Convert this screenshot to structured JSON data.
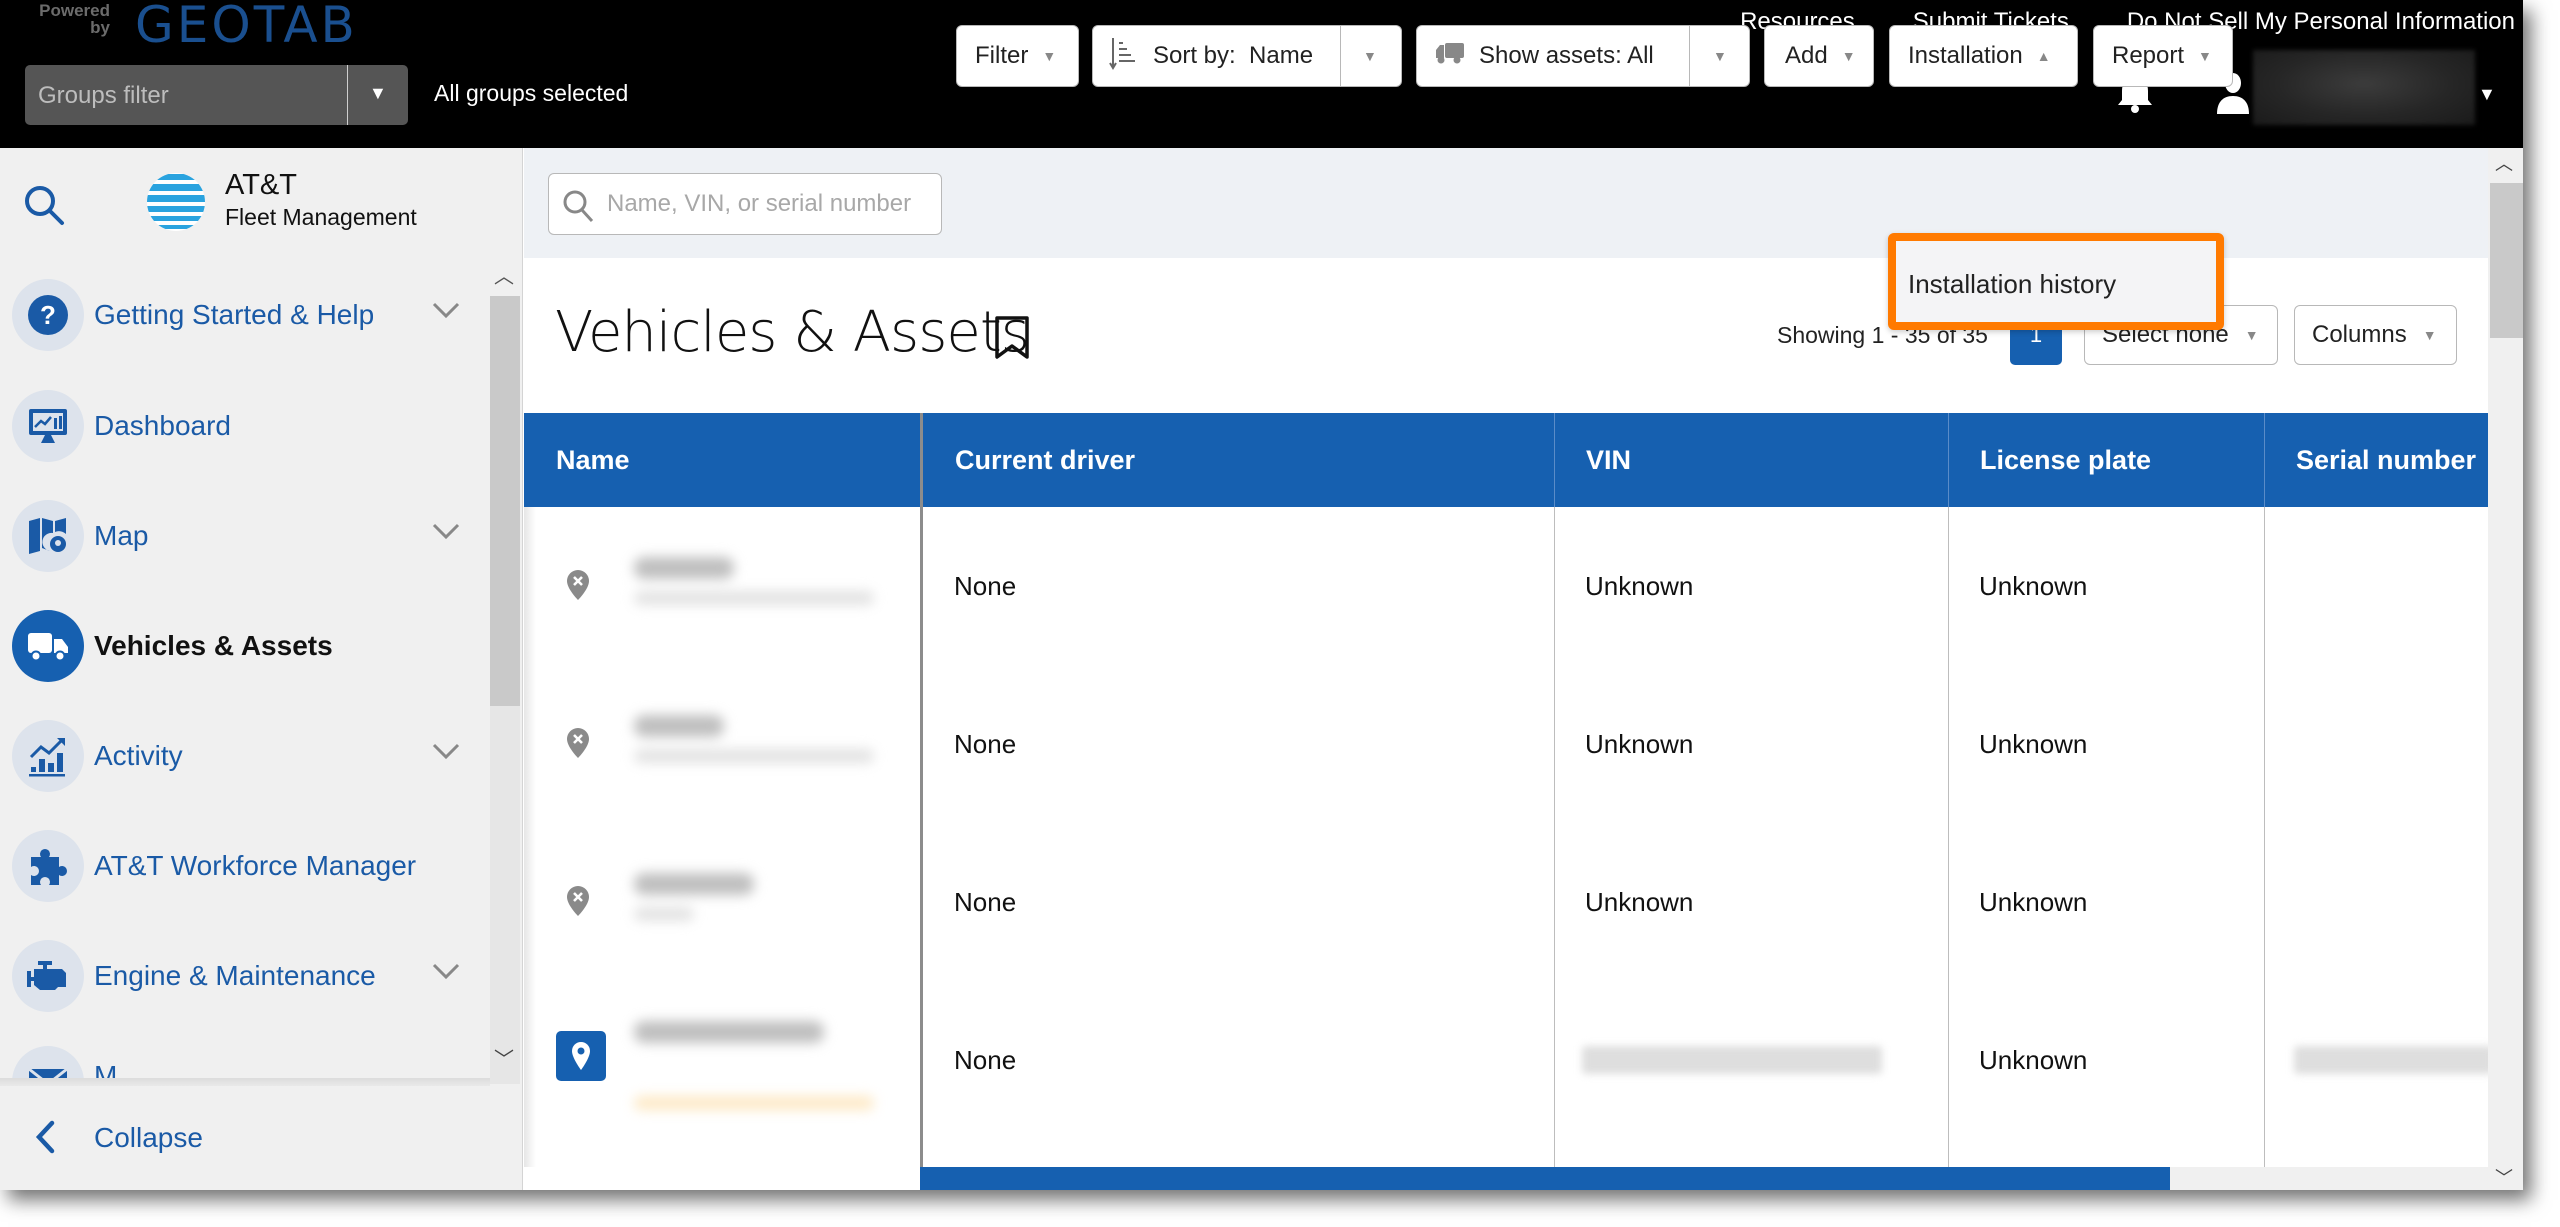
{
  "header": {
    "powered_by": "Powered by",
    "brand": "GEOTAB",
    "groups_filter_placeholder": "Groups filter",
    "groups_selected": "All groups selected",
    "links": [
      "Resources",
      "Submit Tickets",
      "Do Not Sell My Personal Information"
    ],
    "icons": {
      "notifications": "bell-icon",
      "user": "user-icon",
      "user_menu": "caret-down-icon"
    }
  },
  "sidebar": {
    "logo_title": "AT&T",
    "logo_subtitle": "Fleet Management",
    "items": [
      {
        "label": "Getting Started & Help",
        "icon": "help-icon",
        "expandable": true,
        "active": false
      },
      {
        "label": "Dashboard",
        "icon": "dashboard-icon",
        "expandable": false,
        "active": false
      },
      {
        "label": "Map",
        "icon": "map-icon",
        "expandable": true,
        "active": false
      },
      {
        "label": "Vehicles & Assets",
        "icon": "truck-icon",
        "expandable": false,
        "active": true
      },
      {
        "label": "Activity",
        "icon": "activity-chart-icon",
        "expandable": true,
        "active": false
      },
      {
        "label": "AT&T Workforce Manager",
        "icon": "puzzle-icon",
        "expandable": false,
        "active": false
      },
      {
        "label": "Engine & Maintenance",
        "icon": "engine-icon",
        "expandable": true,
        "active": false
      },
      {
        "label": "M...",
        "icon": "mail-icon",
        "expandable": false,
        "active": false
      }
    ],
    "collapse_label": "Collapse"
  },
  "toolbar": {
    "search_placeholder": "Name, VIN, or serial number",
    "filter_label": "Filter",
    "sort_label": "Sort by:  Name",
    "show_assets_label": "Show assets: All",
    "add_label": "Add",
    "installation_label": "Installation",
    "report_label": "Report"
  },
  "installation_menu": {
    "items": [
      "Installation history"
    ],
    "highlight_color": "#ff7a00"
  },
  "page": {
    "title": "Vehicles & Assets",
    "showing": "Showing 1 - 35 of 35",
    "current_page": "1",
    "select_label": "Select none",
    "columns_label": "Columns"
  },
  "table": {
    "columns": [
      "Name",
      "Current driver",
      "VIN",
      "License plate",
      "Serial number"
    ],
    "rows": [
      {
        "status_icon": "no-gps-pin-icon",
        "current_driver": "None",
        "vin": "Unknown",
        "license_plate": "Unknown",
        "serial_number": ""
      },
      {
        "status_icon": "no-gps-pin-icon",
        "current_driver": "None",
        "vin": "Unknown",
        "license_plate": "Unknown",
        "serial_number": ""
      },
      {
        "status_icon": "no-gps-pin-icon",
        "current_driver": "None",
        "vin": "Unknown",
        "license_plate": "Unknown",
        "serial_number": ""
      },
      {
        "status_icon": "location-pin-icon",
        "current_driver": "None",
        "vin": "",
        "license_plate": "Unknown",
        "serial_number": ""
      }
    ]
  },
  "colors": {
    "brand_blue": "#1660b0",
    "header_bg": "#000000",
    "sidebar_bg": "#f0f0f0",
    "toolbar_bg": "#eef1f5",
    "highlight": "#ff7a00"
  }
}
